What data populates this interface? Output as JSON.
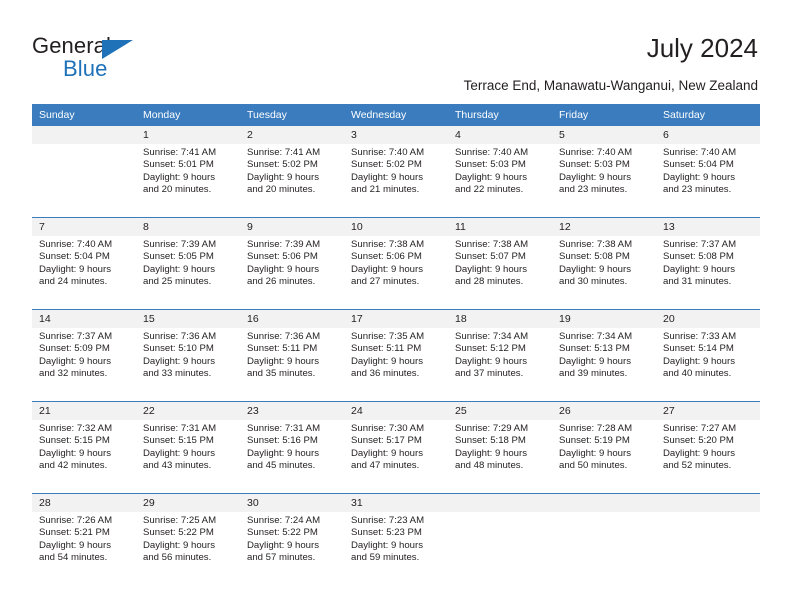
{
  "brand": {
    "word_one": "General",
    "word_two": "Blue",
    "triangle_color": "#1f71b8"
  },
  "header": {
    "month_title": "July 2024",
    "location": "Terrace End, Manawatu-Wanganui, New Zealand",
    "header_bg_color": "#3a7cbe",
    "daynum_bg_color": "#f2f2f2"
  },
  "weekdays": [
    "Sunday",
    "Monday",
    "Tuesday",
    "Wednesday",
    "Thursday",
    "Friday",
    "Saturday"
  ],
  "weeks": [
    [
      {
        "day": "",
        "lines": []
      },
      {
        "day": "1",
        "lines": [
          "Sunrise: 7:41 AM",
          "Sunset: 5:01 PM",
          "Daylight: 9 hours",
          "and 20 minutes."
        ]
      },
      {
        "day": "2",
        "lines": [
          "Sunrise: 7:41 AM",
          "Sunset: 5:02 PM",
          "Daylight: 9 hours",
          "and 20 minutes."
        ]
      },
      {
        "day": "3",
        "lines": [
          "Sunrise: 7:40 AM",
          "Sunset: 5:02 PM",
          "Daylight: 9 hours",
          "and 21 minutes."
        ]
      },
      {
        "day": "4",
        "lines": [
          "Sunrise: 7:40 AM",
          "Sunset: 5:03 PM",
          "Daylight: 9 hours",
          "and 22 minutes."
        ]
      },
      {
        "day": "5",
        "lines": [
          "Sunrise: 7:40 AM",
          "Sunset: 5:03 PM",
          "Daylight: 9 hours",
          "and 23 minutes."
        ]
      },
      {
        "day": "6",
        "lines": [
          "Sunrise: 7:40 AM",
          "Sunset: 5:04 PM",
          "Daylight: 9 hours",
          "and 23 minutes."
        ]
      }
    ],
    [
      {
        "day": "7",
        "lines": [
          "Sunrise: 7:40 AM",
          "Sunset: 5:04 PM",
          "Daylight: 9 hours",
          "and 24 minutes."
        ]
      },
      {
        "day": "8",
        "lines": [
          "Sunrise: 7:39 AM",
          "Sunset: 5:05 PM",
          "Daylight: 9 hours",
          "and 25 minutes."
        ]
      },
      {
        "day": "9",
        "lines": [
          "Sunrise: 7:39 AM",
          "Sunset: 5:06 PM",
          "Daylight: 9 hours",
          "and 26 minutes."
        ]
      },
      {
        "day": "10",
        "lines": [
          "Sunrise: 7:38 AM",
          "Sunset: 5:06 PM",
          "Daylight: 9 hours",
          "and 27 minutes."
        ]
      },
      {
        "day": "11",
        "lines": [
          "Sunrise: 7:38 AM",
          "Sunset: 5:07 PM",
          "Daylight: 9 hours",
          "and 28 minutes."
        ]
      },
      {
        "day": "12",
        "lines": [
          "Sunrise: 7:38 AM",
          "Sunset: 5:08 PM",
          "Daylight: 9 hours",
          "and 30 minutes."
        ]
      },
      {
        "day": "13",
        "lines": [
          "Sunrise: 7:37 AM",
          "Sunset: 5:08 PM",
          "Daylight: 9 hours",
          "and 31 minutes."
        ]
      }
    ],
    [
      {
        "day": "14",
        "lines": [
          "Sunrise: 7:37 AM",
          "Sunset: 5:09 PM",
          "Daylight: 9 hours",
          "and 32 minutes."
        ]
      },
      {
        "day": "15",
        "lines": [
          "Sunrise: 7:36 AM",
          "Sunset: 5:10 PM",
          "Daylight: 9 hours",
          "and 33 minutes."
        ]
      },
      {
        "day": "16",
        "lines": [
          "Sunrise: 7:36 AM",
          "Sunset: 5:11 PM",
          "Daylight: 9 hours",
          "and 35 minutes."
        ]
      },
      {
        "day": "17",
        "lines": [
          "Sunrise: 7:35 AM",
          "Sunset: 5:11 PM",
          "Daylight: 9 hours",
          "and 36 minutes."
        ]
      },
      {
        "day": "18",
        "lines": [
          "Sunrise: 7:34 AM",
          "Sunset: 5:12 PM",
          "Daylight: 9 hours",
          "and 37 minutes."
        ]
      },
      {
        "day": "19",
        "lines": [
          "Sunrise: 7:34 AM",
          "Sunset: 5:13 PM",
          "Daylight: 9 hours",
          "and 39 minutes."
        ]
      },
      {
        "day": "20",
        "lines": [
          "Sunrise: 7:33 AM",
          "Sunset: 5:14 PM",
          "Daylight: 9 hours",
          "and 40 minutes."
        ]
      }
    ],
    [
      {
        "day": "21",
        "lines": [
          "Sunrise: 7:32 AM",
          "Sunset: 5:15 PM",
          "Daylight: 9 hours",
          "and 42 minutes."
        ]
      },
      {
        "day": "22",
        "lines": [
          "Sunrise: 7:31 AM",
          "Sunset: 5:15 PM",
          "Daylight: 9 hours",
          "and 43 minutes."
        ]
      },
      {
        "day": "23",
        "lines": [
          "Sunrise: 7:31 AM",
          "Sunset: 5:16 PM",
          "Daylight: 9 hours",
          "and 45 minutes."
        ]
      },
      {
        "day": "24",
        "lines": [
          "Sunrise: 7:30 AM",
          "Sunset: 5:17 PM",
          "Daylight: 9 hours",
          "and 47 minutes."
        ]
      },
      {
        "day": "25",
        "lines": [
          "Sunrise: 7:29 AM",
          "Sunset: 5:18 PM",
          "Daylight: 9 hours",
          "and 48 minutes."
        ]
      },
      {
        "day": "26",
        "lines": [
          "Sunrise: 7:28 AM",
          "Sunset: 5:19 PM",
          "Daylight: 9 hours",
          "and 50 minutes."
        ]
      },
      {
        "day": "27",
        "lines": [
          "Sunrise: 7:27 AM",
          "Sunset: 5:20 PM",
          "Daylight: 9 hours",
          "and 52 minutes."
        ]
      }
    ],
    [
      {
        "day": "28",
        "lines": [
          "Sunrise: 7:26 AM",
          "Sunset: 5:21 PM",
          "Daylight: 9 hours",
          "and 54 minutes."
        ]
      },
      {
        "day": "29",
        "lines": [
          "Sunrise: 7:25 AM",
          "Sunset: 5:22 PM",
          "Daylight: 9 hours",
          "and 56 minutes."
        ]
      },
      {
        "day": "30",
        "lines": [
          "Sunrise: 7:24 AM",
          "Sunset: 5:22 PM",
          "Daylight: 9 hours",
          "and 57 minutes."
        ]
      },
      {
        "day": "31",
        "lines": [
          "Sunrise: 7:23 AM",
          "Sunset: 5:23 PM",
          "Daylight: 9 hours",
          "and 59 minutes."
        ]
      },
      {
        "day": "",
        "lines": []
      },
      {
        "day": "",
        "lines": []
      },
      {
        "day": "",
        "lines": []
      }
    ]
  ]
}
